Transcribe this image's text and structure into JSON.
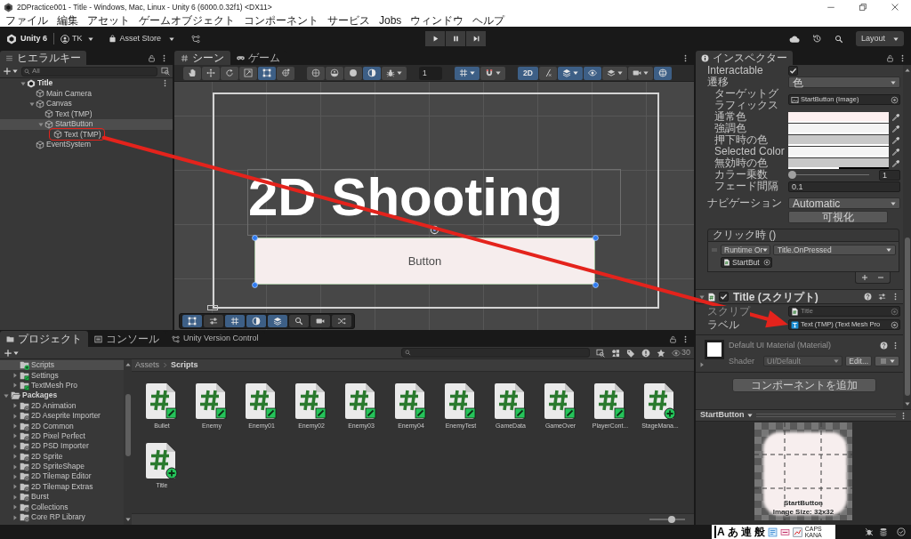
{
  "window": {
    "title": "2DPractice001 - Title - Windows, Mac, Linux - Unity 6 (6000.0.32f1) <DX11>"
  },
  "menu": [
    "ファイル",
    "編集",
    "アセット",
    "ゲームオブジェクト",
    "コンポーネント",
    "サービス",
    "Jobs",
    "ウィンドウ",
    "ヘルプ"
  ],
  "toolbar": {
    "product": "Unity 6",
    "account": "TK",
    "store": "Asset Store",
    "playback": [
      {
        "kind": "play",
        "selected": false
      },
      {
        "kind": "pause",
        "selected": false
      },
      {
        "kind": "step",
        "selected": false
      }
    ],
    "layout": "Layout"
  },
  "hierarchy": {
    "tab": "ヒエラルキー",
    "search": {
      "placeholder": "All"
    },
    "tree": [
      {
        "label": "Title",
        "kind": "scene",
        "expanded": true,
        "selected": false,
        "circled": false,
        "children": [
          {
            "label": "Main Camera",
            "kind": "object",
            "selected": false,
            "circled": false
          },
          {
            "label": "Canvas",
            "kind": "object",
            "expanded": true,
            "selected": false,
            "circled": false,
            "children": [
              {
                "label": "Text (TMP)",
                "kind": "object",
                "selected": false,
                "circled": false
              },
              {
                "label": "StartButton",
                "kind": "object",
                "expanded": true,
                "selected": true,
                "circled": false,
                "children": [
                  {
                    "label": "Text (TMP)",
                    "kind": "object",
                    "selected": false,
                    "circled": true
                  }
                ]
              }
            ]
          },
          {
            "label": "EventSystem",
            "kind": "object",
            "selected": false,
            "circled": false
          }
        ]
      }
    ]
  },
  "scene": {
    "tabs": [
      {
        "label": "シーン",
        "kind": "scene",
        "selected": true
      },
      {
        "label": "ゲーム",
        "kind": "game",
        "selected": false
      }
    ],
    "tool_groups": [
      [
        {
          "kind": "hand",
          "selected": false,
          "dropdown": false
        },
        {
          "kind": "move",
          "selected": false,
          "dropdown": false
        },
        {
          "kind": "rotate",
          "selected": false,
          "dropdown": false
        },
        {
          "kind": "scale",
          "selected": false,
          "dropdown": false
        },
        {
          "kind": "rect",
          "selected": true,
          "dropdown": false
        },
        {
          "kind": "transform",
          "selected": false,
          "dropdown": false
        }
      ],
      [
        {
          "kind": "globe",
          "selected": false,
          "dropdown": false
        },
        {
          "kind": "pivot",
          "selected": false,
          "dropdown": false
        },
        {
          "kind": "sphere",
          "selected": false,
          "dropdown": false
        },
        {
          "kind": "moon",
          "selected": true,
          "dropdown": false
        },
        {
          "kind": "bug",
          "selected": false,
          "dropdown": true
        }
      ],
      [
        {
          "kind": "field",
          "value": "1"
        }
      ],
      [
        {
          "kind": "grid",
          "selected": true,
          "dropdown": true
        },
        {
          "kind": "magnet",
          "selected": false,
          "dropdown": true
        }
      ],
      [
        {
          "kind": "label",
          "label": "2D",
          "selected": true,
          "dropdown": false
        },
        {
          "kind": "slash",
          "selected": false,
          "dropdown": false
        },
        {
          "kind": "layers",
          "selected": true,
          "dropdown": true
        },
        {
          "kind": "eye",
          "selected": true,
          "dropdown": false
        },
        {
          "kind": "stack",
          "selected": false,
          "dropdown": true
        },
        {
          "kind": "camera",
          "selected": false,
          "dropdown": true
        },
        {
          "kind": "gizmo",
          "selected": true,
          "dropdown": false
        }
      ]
    ],
    "view": {
      "title": "2D Shooting",
      "button": "Button"
    },
    "overlay_tools": [
      {
        "kind": "rect",
        "selected": true
      },
      {
        "kind": "sliders",
        "selected": false
      },
      {
        "kind": "grid",
        "selected": true
      },
      {
        "kind": "moon",
        "selected": true
      },
      {
        "kind": "layers",
        "selected": true
      },
      {
        "kind": "search",
        "selected": false
      },
      {
        "kind": "camera",
        "selected": false
      },
      {
        "kind": "shuffle",
        "selected": false
      }
    ]
  },
  "inspector": {
    "tab": "インスペクター",
    "fields": [
      {
        "kind": "toggle",
        "label": "Interactable",
        "checked": true
      },
      {
        "kind": "dropdown",
        "label": "遷移",
        "value": "色",
        "children": [
          {
            "kind": "object",
            "label": "ターゲットグラフィックス",
            "value": "StartButton (Image)"
          },
          {
            "kind": "color",
            "label": "通常色",
            "color": "#fcefef",
            "level": 1
          },
          {
            "kind": "color",
            "label": "強調色",
            "color": "#f4f4f4",
            "level": 1
          },
          {
            "kind": "color",
            "label": "押下時の色",
            "color": "#c8c8c8",
            "level": 1
          },
          {
            "kind": "color",
            "label": "Selected Color",
            "color": "#f4f4f4",
            "level": 1
          },
          {
            "kind": "color",
            "label": "無効時の色",
            "color": "#c8c8c8",
            "level": 0.5
          },
          {
            "kind": "slider",
            "label": "カラー乗数",
            "level": 0,
            "value": "1"
          },
          {
            "kind": "number",
            "label": "フェード間隔",
            "value": "0.1"
          }
        ]
      },
      {
        "kind": "dropdown",
        "label": "ナビゲーション",
        "value": "Automatic"
      },
      {
        "kind": "button",
        "label": "可視化"
      }
    ],
    "event": {
      "title": "クリック時 ()",
      "entries": [
        {
          "mode": "Runtime Or",
          "function": "Title.OnPressed",
          "target": "StartBut"
        }
      ]
    },
    "components": [
      {
        "title": "Title (スクリプト)",
        "enabled": true,
        "expanded": true,
        "fields": [
          {
            "label": "スクリプ",
            "value": "Title",
            "kind": "script",
            "disabled": true,
            "pointed": false
          },
          {
            "label": "ラベル",
            "value": "Text (TMP) (Text Mesh Pro",
            "kind": "text",
            "disabled": false,
            "pointed": true
          }
        ]
      }
    ],
    "material": {
      "title": "Default UI Material (Material)",
      "shader_label": "Shader",
      "shader": "UI/Default",
      "edit": "Edit..."
    },
    "add_component": "コンポーネントを追加",
    "preview": {
      "title": "StartButton",
      "caption": "StartButton",
      "size": "Image Size: 32x32"
    }
  },
  "project": {
    "tabs": [
      {
        "label": "プロジェクト",
        "kind": "project",
        "selected": true
      },
      {
        "label": "コンソール",
        "kind": "console",
        "selected": false
      },
      {
        "label": "Unity Version Control",
        "kind": "vcs",
        "selected": false
      }
    ],
    "hidden_count": "30",
    "tree": [
      {
        "children": [
          {
            "label": "Scripts",
            "kind": "added",
            "selected": true
          },
          {
            "label": "Settings",
            "kind": "modified",
            "expanded": false,
            "selected": false
          },
          {
            "label": "TextMesh Pro",
            "kind": "modified",
            "expanded": false,
            "selected": false
          }
        ]
      },
      {
        "label": "Packages",
        "kind": "root",
        "expanded": true,
        "selected": false,
        "children": [
          {
            "label": "2D Animation",
            "kind": "package",
            "expanded": false,
            "selected": false
          },
          {
            "label": "2D Aseprite Importer",
            "kind": "package",
            "expanded": false,
            "selected": false
          },
          {
            "label": "2D Common",
            "kind": "package",
            "expanded": false,
            "selected": false
          },
          {
            "label": "2D Pixel Perfect",
            "kind": "package",
            "expanded": false,
            "selected": false
          },
          {
            "label": "2D PSD Importer",
            "kind": "package",
            "expanded": false,
            "selected": false
          },
          {
            "label": "2D Sprite",
            "kind": "package",
            "expanded": false,
            "selected": false
          },
          {
            "label": "2D SpriteShape",
            "kind": "package",
            "expanded": false,
            "selected": false
          },
          {
            "label": "2D Tilemap Editor",
            "kind": "package",
            "expanded": false,
            "selected": false
          },
          {
            "label": "2D Tilemap Extras",
            "kind": "package",
            "expanded": false,
            "selected": false
          },
          {
            "label": "Burst",
            "kind": "package",
            "expanded": false,
            "selected": false
          },
          {
            "label": "Collections",
            "kind": "package",
            "expanded": false,
            "selected": false
          },
          {
            "label": "Core RP Library",
            "kind": "package",
            "expanded": false,
            "selected": false
          }
        ]
      }
    ],
    "breadcrumb": [
      "Assets",
      "Scripts"
    ],
    "assets": [
      {
        "label": "Bullet",
        "kind": "modified"
      },
      {
        "label": "Enemy",
        "kind": "modified"
      },
      {
        "label": "Enemy01",
        "kind": "modified"
      },
      {
        "label": "Enemy02",
        "kind": "modified"
      },
      {
        "label": "Enemy03",
        "kind": "modified"
      },
      {
        "label": "Enemy04",
        "kind": "modified"
      },
      {
        "label": "EnemyTest",
        "kind": "modified"
      },
      {
        "label": "GameData",
        "kind": "modified"
      },
      {
        "label": "GameOver",
        "kind": "modified"
      },
      {
        "label": "PlayerCont...",
        "kind": "modified"
      },
      {
        "label": "StageMana...",
        "kind": "added"
      },
      {
        "label": "Title",
        "kind": "added"
      }
    ],
    "zoom": {
      "level": 0.65
    }
  },
  "status_bar": {
    "ime": {
      "mode": "A",
      "items": [
        "あ",
        "連",
        "般"
      ],
      "caps": "CAPS",
      "kana": "KANA"
    }
  }
}
